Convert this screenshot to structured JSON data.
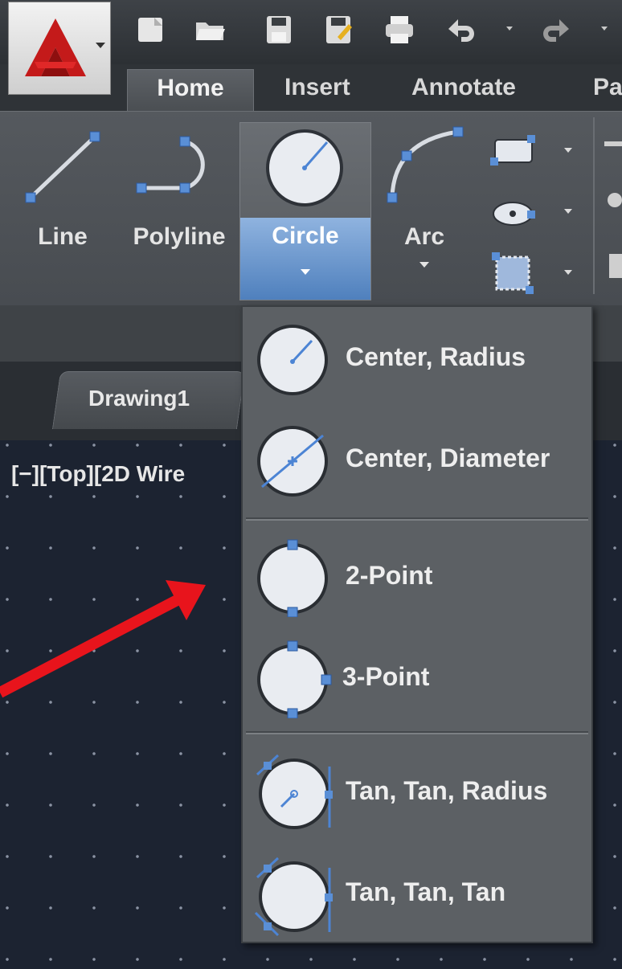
{
  "ribbon": {
    "tabs": [
      {
        "label": "Home",
        "active": true
      },
      {
        "label": "Insert"
      },
      {
        "label": "Annotate"
      },
      {
        "label": "Pa"
      }
    ],
    "tools": {
      "line": "Line",
      "polyline": "Polyline",
      "circle": "Circle",
      "arc": "Arc"
    }
  },
  "document": {
    "tab_label": "Drawing1",
    "viewport_label": "[−][Top][2D Wire"
  },
  "circle_menu": {
    "items": [
      {
        "label": "Center, Radius",
        "icon": "circle-center-radius-icon"
      },
      {
        "label": "Center, Diameter",
        "icon": "circle-center-diameter-icon"
      },
      {
        "label": "2-Point",
        "icon": "circle-2-point-icon"
      },
      {
        "label": "3-Point",
        "icon": "circle-3-point-icon"
      },
      {
        "label": "Tan, Tan, Radius",
        "icon": "circle-tan-tan-radius-icon"
      },
      {
        "label": "Tan, Tan, Tan",
        "icon": "circle-tan-tan-tan-icon"
      }
    ]
  },
  "colors": {
    "canvas": "#1c2331",
    "ribbon": "#4e5257",
    "menu": "#5c6064",
    "accent_blue": "#4f80bd",
    "annotation_arrow": "#e8141c"
  }
}
